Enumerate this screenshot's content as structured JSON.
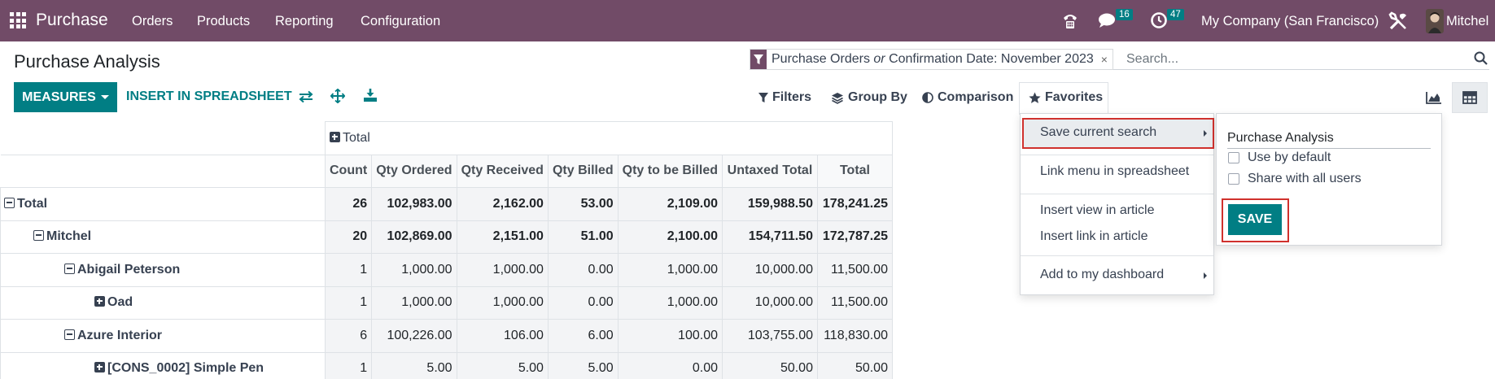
{
  "navbar": {
    "app_name": "Purchase",
    "menu": [
      "Orders",
      "Products",
      "Reporting",
      "Configuration"
    ],
    "messages_count": "16",
    "activities_count": "47",
    "company": "My Company (San Francisco)",
    "user": "Mitchel"
  },
  "page": {
    "title": "Purchase Analysis"
  },
  "search": {
    "facet_part1": "Purchase Orders",
    "facet_or": "or",
    "facet_part2": "Confirmation Date: November 2023",
    "facet_remove": "×",
    "placeholder": "Search..."
  },
  "toolbar": {
    "measures_label": "MEASURES",
    "insert_label": "INSERT IN SPREADSHEET",
    "filters_label": "Filters",
    "groupby_label": "Group By",
    "comparison_label": "Comparison",
    "favorites_label": "Favorites"
  },
  "pivot": {
    "col_group": "Total",
    "columns": [
      "Count",
      "Qty Ordered",
      "Qty Received",
      "Qty Billed",
      "Qty to be Billed",
      "Untaxed Total",
      "Total"
    ],
    "rows": [
      {
        "label": "Total",
        "state": "expanded",
        "values": [
          "26",
          "102,983.00",
          "2,162.00",
          "53.00",
          "2,109.00",
          "159,988.50",
          "178,241.25"
        ]
      },
      {
        "label": "Mitchel",
        "state": "expanded",
        "values": [
          "20",
          "102,869.00",
          "2,151.00",
          "51.00",
          "2,100.00",
          "154,711.50",
          "172,787.25"
        ]
      },
      {
        "label": "Abigail Peterson",
        "state": "expanded",
        "values": [
          "1",
          "1,000.00",
          "1,000.00",
          "0.00",
          "1,000.00",
          "10,000.00",
          "11,500.00"
        ]
      },
      {
        "label": "Oad",
        "state": "collapsed",
        "values": [
          "1",
          "1,000.00",
          "1,000.00",
          "0.00",
          "1,000.00",
          "10,000.00",
          "11,500.00"
        ]
      },
      {
        "label": "Azure Interior",
        "state": "expanded",
        "values": [
          "6",
          "100,226.00",
          "106.00",
          "6.00",
          "100.00",
          "103,755.00",
          "118,830.00"
        ]
      },
      {
        "label": "[CONS_0002] Simple Pen",
        "state": "collapsed",
        "values": [
          "1",
          "5.00",
          "5.00",
          "5.00",
          "0.00",
          "50.00",
          "50.00"
        ]
      }
    ]
  },
  "favorites_menu": {
    "save_current_search": "Save current search",
    "link_menu": "Link menu in spreadsheet",
    "insert_view": "Insert view in article",
    "insert_link": "Insert link in article",
    "add_dashboard": "Add to my dashboard"
  },
  "save_panel": {
    "name_value": "Purchase Analysis",
    "use_default": "Use by default",
    "share_all": "Share with all users",
    "save_label": "SAVE"
  },
  "colors": {
    "brand": "#714b67",
    "accent": "#017e84",
    "highlight": "#d0312d"
  }
}
